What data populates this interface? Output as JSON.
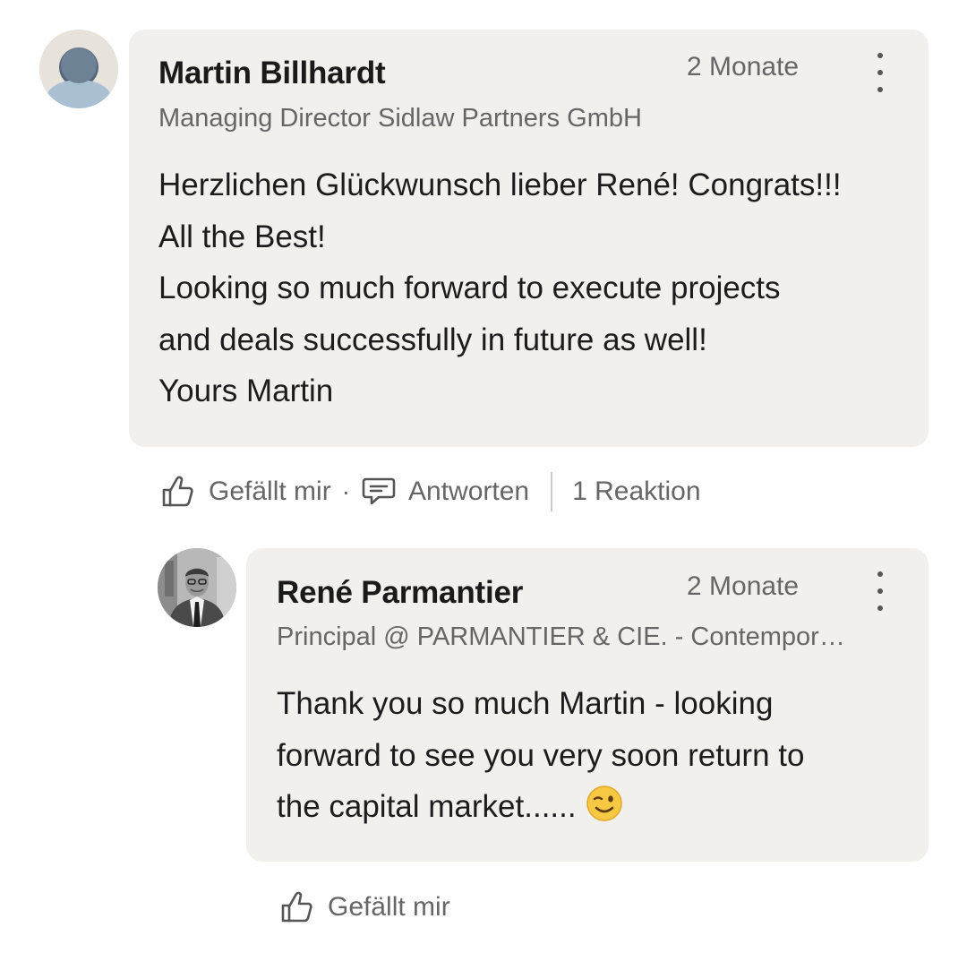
{
  "comment": {
    "author": "Martin Billhardt",
    "headline": "Managing Director Sidlaw Partners GmbH",
    "time": "2 Monate",
    "body_lines": [
      "Herzlichen Glückwunsch lieber René! Congrats!!!",
      "All the Best!",
      "Looking so much forward to execute projects",
      "and deals successfully in future as well!",
      "Yours Martin"
    ],
    "actions": {
      "like_label": "Gefällt mir",
      "separator": "·",
      "reply_label": "Antworten",
      "reactions_label": "1 Reaktion"
    }
  },
  "reply": {
    "author": "René Parmantier",
    "headline": "Principal @ PARMANTIER & CIE. - Contempor…",
    "time": "2 Monate",
    "body_lines": [
      "Thank you so much Martin - looking",
      "forward to see you very soon return to",
      "the capital market......"
    ],
    "emoji": "wink-emoji",
    "actions": {
      "like_label": "Gefällt mir"
    }
  },
  "icons": {
    "like": "thumbs-up-icon",
    "reply": "speech-bubble-icon",
    "more": "vertical-ellipsis-icon"
  }
}
